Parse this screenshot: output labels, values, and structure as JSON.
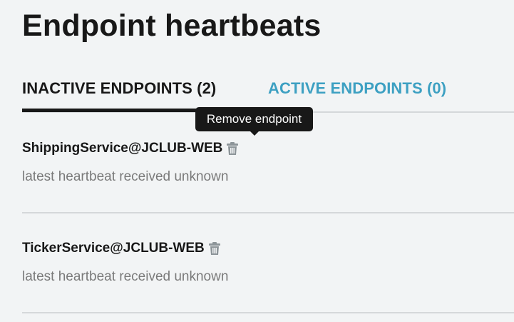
{
  "page": {
    "title": "Endpoint heartbeats"
  },
  "tabs": [
    {
      "label": "INACTIVE ENDPOINTS (2)",
      "selected": true
    },
    {
      "label": "ACTIVE ENDPOINTS (0)",
      "selected": false
    }
  ],
  "tooltip": {
    "text": "Remove endpoint"
  },
  "endpoints": [
    {
      "name": "ShippingService@JCLUB-WEB",
      "status": "latest heartbeat received unknown",
      "remove_icon": "trash-icon"
    },
    {
      "name": "TickerService@JCLUB-WEB",
      "status": "latest heartbeat received unknown",
      "remove_icon": "trash-icon"
    }
  ],
  "colors": {
    "background": "#f2f4f5",
    "text": "#181818",
    "link_tab": "#3da0c2",
    "muted_text": "#7a7a7a",
    "icon": "#8d9599",
    "divider": "#d5d8da"
  }
}
